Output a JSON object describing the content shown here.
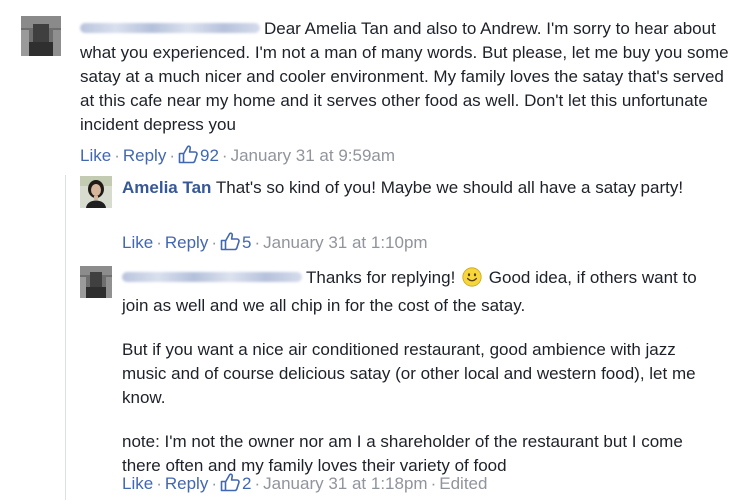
{
  "comments": [
    {
      "author_blurred": true,
      "text": "Dear Amelia Tan and also to Andrew. I'm sorry to hear about what you experienced. I'm not a man of many words. But please, let me buy you some satay at a much nicer and cooler environment. My family loves the satay that's served at this cafe near my home and it serves other food as well. Don't let this unfortunate incident depress you",
      "like_label": "Like",
      "reply_label": "Reply",
      "likes": "92",
      "timestamp": "January 31 at 9:59am"
    },
    {
      "author": "Amelia Tan",
      "text": "That's so kind of you! Maybe we should all have a satay party!",
      "like_label": "Like",
      "reply_label": "Reply",
      "likes": "5",
      "timestamp": "January 31 at 1:10pm"
    },
    {
      "author_blurred": true,
      "text_before_emoji": "Thanks for replying!",
      "text_after_emoji": "Good idea, if others want to join as well and we all chip in for the cost of the satay.",
      "paragraph2": "But if you want a nice air conditioned restaurant, good ambience with jazz music and of course delicious satay (or other local and western food), let me know.",
      "paragraph3": "note: I'm not the owner nor am I a shareholder of the restaurant but I come there often and my family loves their variety of food",
      "like_label": "Like",
      "reply_label": "Reply",
      "likes": "2",
      "timestamp": "January 31 at 1:18pm",
      "edited_label": "Edited"
    }
  ],
  "colors": {
    "link": "#4267b2",
    "name": "#365899",
    "meta": "#90949c",
    "text": "#1d2129"
  },
  "icons": [
    "thumbs-up-icon",
    "smiley-emoji-icon"
  ]
}
